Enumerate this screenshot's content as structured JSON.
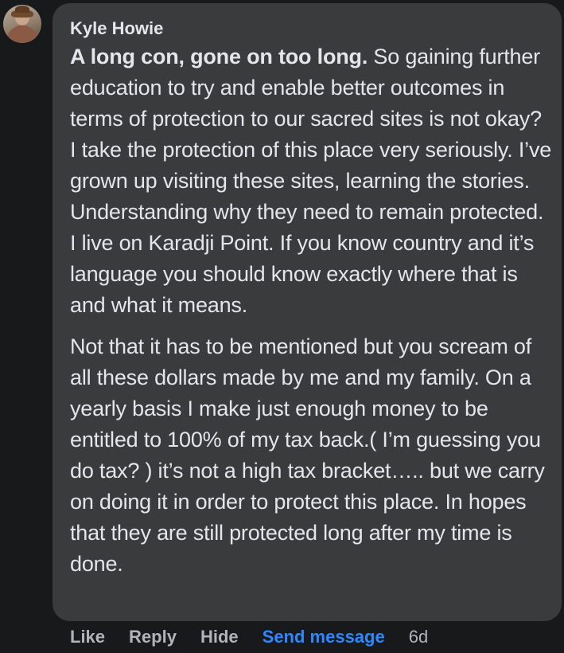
{
  "comment": {
    "author": "Kyle Howie",
    "lead_text": "A long con, gone on too long.",
    "paragraph1_rest": " So gaining further education to try and enable better outcomes in terms of protection to our sacred sites is not okay? I take the protection of this place very seriously. I’ve grown up visiting these sites, learning the stories. Understanding why they need to remain protected. I live on Karadji Point. If you know country and it’s language you should know exactly where that is and what it means.",
    "paragraph2": "Not that it has to be mentioned but you scream of all these dollars made by me and my family. On a yearly basis I make just enough money to be entitled to 100% of my tax back.( I’m guessing you do tax? ) it’s not a high tax bracket….. but we carry on doing it in order to protect this place. In hopes that they are still protected long after my time is done."
  },
  "actions": {
    "like": "Like",
    "reply": "Reply",
    "hide": "Hide",
    "send_message": "Send message",
    "timestamp": "6d"
  },
  "colors": {
    "background": "#18191a",
    "bubble": "#3a3b3c",
    "text": "#e4e6eb",
    "muted": "#b0b3b8",
    "link": "#2d88ff"
  }
}
